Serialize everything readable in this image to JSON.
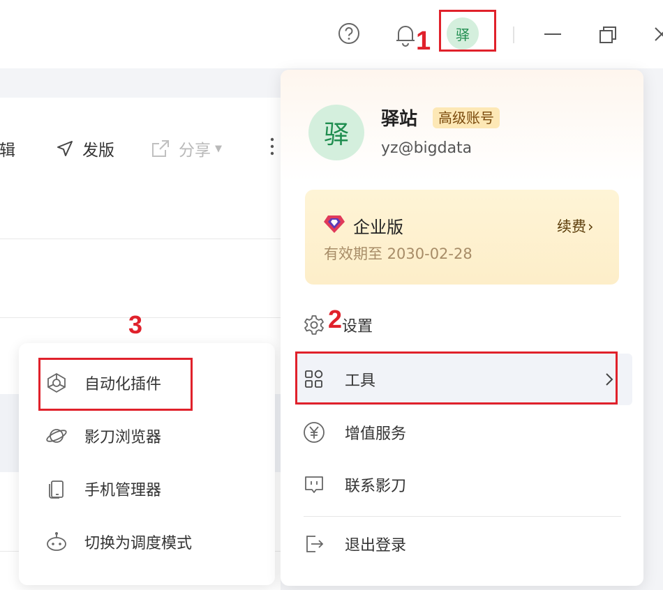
{
  "header": {
    "avatar_char": "驿",
    "icons": [
      "help-icon",
      "bell-icon",
      "minimize-icon",
      "restore-icon",
      "close-icon"
    ]
  },
  "toolbar": {
    "edit_label": "编辑",
    "publish_label": "发版",
    "share_label": "分享"
  },
  "annotations": {
    "step1": "1",
    "step2": "2",
    "step3": "3"
  },
  "user_menu": {
    "avatar_char": "驿",
    "name": "驿站",
    "badge": "高级账号",
    "email": "yz@bigdata",
    "plan": {
      "name": "企业版",
      "renew_label": "续费",
      "expiry": "有效期至 2030-02-28"
    },
    "items": [
      {
        "label": "设置",
        "icon": "gear-icon"
      },
      {
        "label": "工具",
        "icon": "apps-icon"
      },
      {
        "label": "增值服务",
        "icon": "yuan-icon"
      },
      {
        "label": "联系影刀",
        "icon": "chat-icon"
      },
      {
        "label": "退出登录",
        "icon": "logout-icon"
      }
    ]
  },
  "tools_submenu": {
    "items": [
      {
        "label": "自动化插件",
        "icon": "plugin-icon"
      },
      {
        "label": "影刀浏览器",
        "icon": "planet-icon"
      },
      {
        "label": "手机管理器",
        "icon": "phone-icon"
      },
      {
        "label": "切换为调度模式",
        "icon": "robot-icon"
      }
    ]
  },
  "colors": {
    "highlight": "#e0212b",
    "avatar_bg": "#d4efdd",
    "avatar_fg": "#1f8d4f",
    "badge_bg": "#fde8b6"
  }
}
